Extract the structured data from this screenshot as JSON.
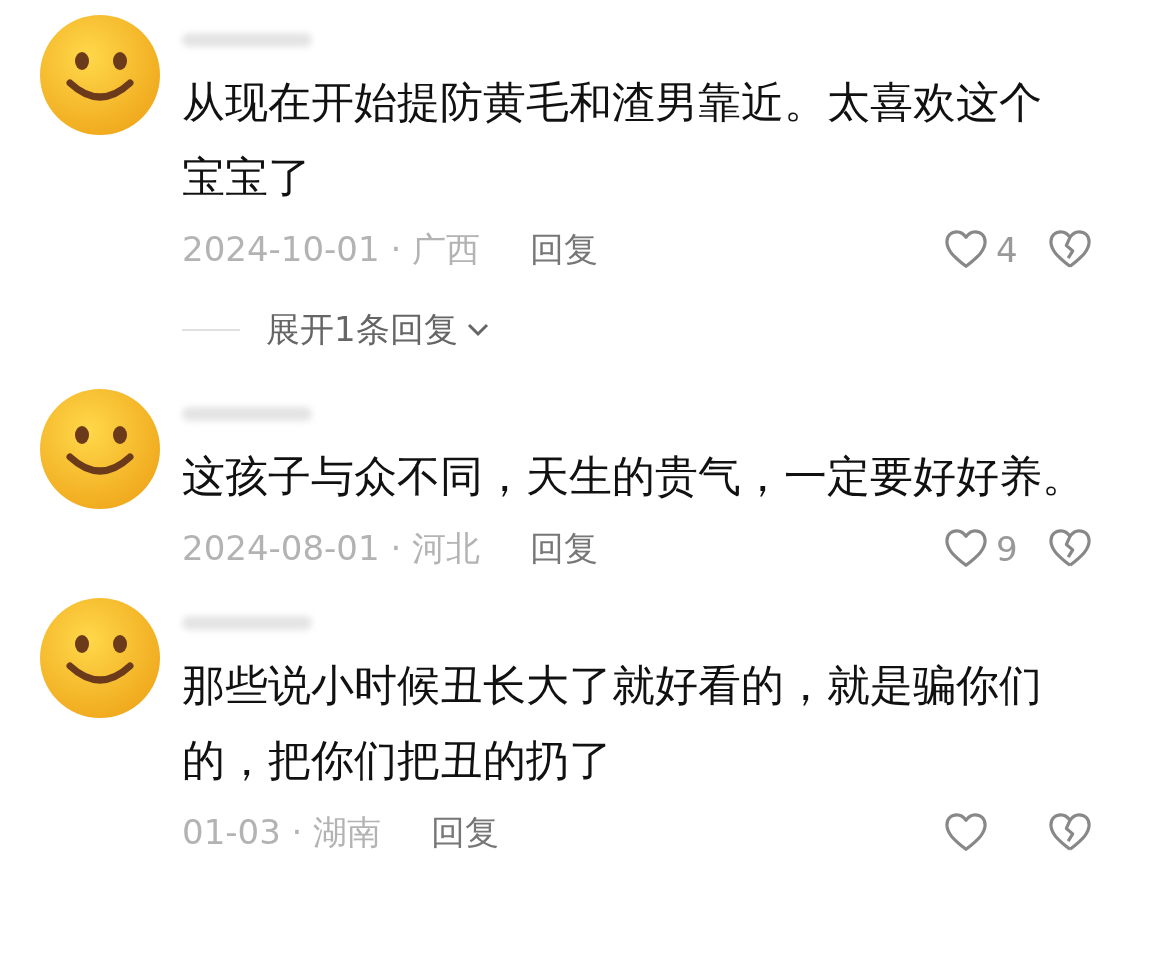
{
  "comments": [
    {
      "text_lines": [
        "从现在开始提防黄毛和渣男靠近。太喜欢这个",
        "宝宝了"
      ],
      "meta": "2024-10-01 · 广西",
      "reply": "回复",
      "likes": "4",
      "expand": "展开1条回复"
    },
    {
      "text_lines": [
        "这孩子与众不同，天生的贵气，一定要好好养。"
      ],
      "meta": "2024-08-01 · 河北",
      "reply": "回复",
      "likes": "9"
    },
    {
      "text_lines": [
        "那些说小时候丑长大了就好看的，就是骗你们",
        "的，把你们把丑的扔了"
      ],
      "meta": "01-03 · 湖南",
      "reply": "回复"
    }
  ]
}
